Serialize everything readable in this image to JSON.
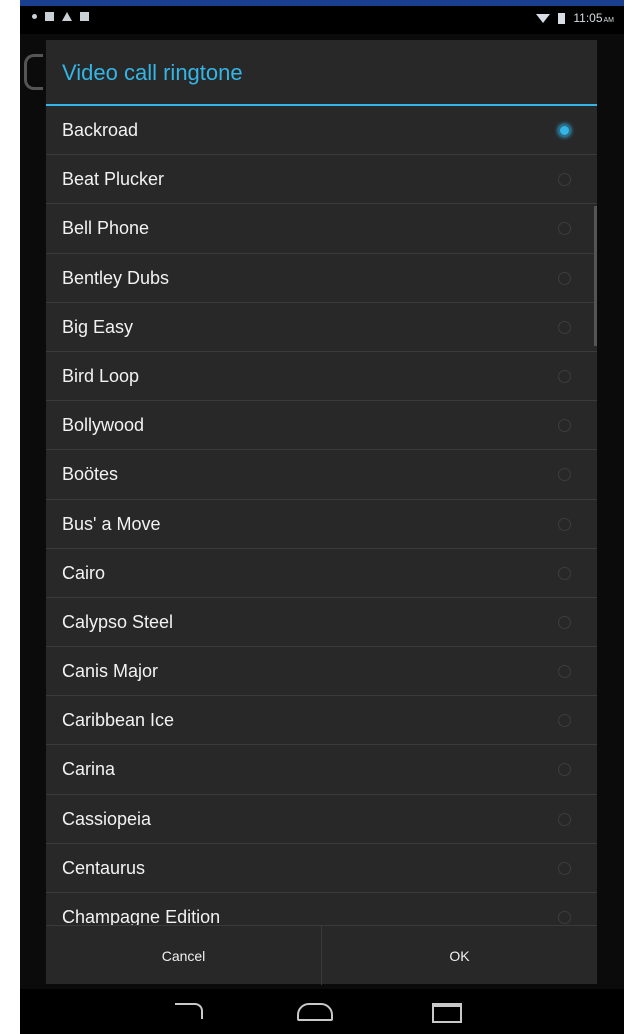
{
  "status_bar": {
    "time": "11:05",
    "ampm": "AM",
    "left_icons": [
      "dot-icon",
      "screen-icon",
      "warning-icon",
      "image-icon"
    ],
    "right_icons": [
      "wifi-icon",
      "battery-icon"
    ]
  },
  "dialog": {
    "title": "Video call ringtone",
    "selected": "Backroad",
    "items": [
      "Backroad",
      "Beat Plucker",
      "Bell Phone",
      "Bentley Dubs",
      "Big Easy",
      "Bird Loop",
      "Bollywood",
      "Boötes",
      "Bus' a Move",
      "Cairo",
      "Calypso Steel",
      "Canis Major",
      "Caribbean Ice",
      "Carina",
      "Cassiopeia",
      "Centaurus",
      "Champagne Edition"
    ],
    "cancel_label": "Cancel",
    "ok_label": "OK"
  },
  "nav_bar": {
    "icons": [
      "back-icon",
      "home-icon",
      "recent-apps-icon"
    ]
  },
  "colors": {
    "accent": "#33b5e5",
    "dialog_bg": "#282828",
    "divider": "#3a3a3a"
  }
}
